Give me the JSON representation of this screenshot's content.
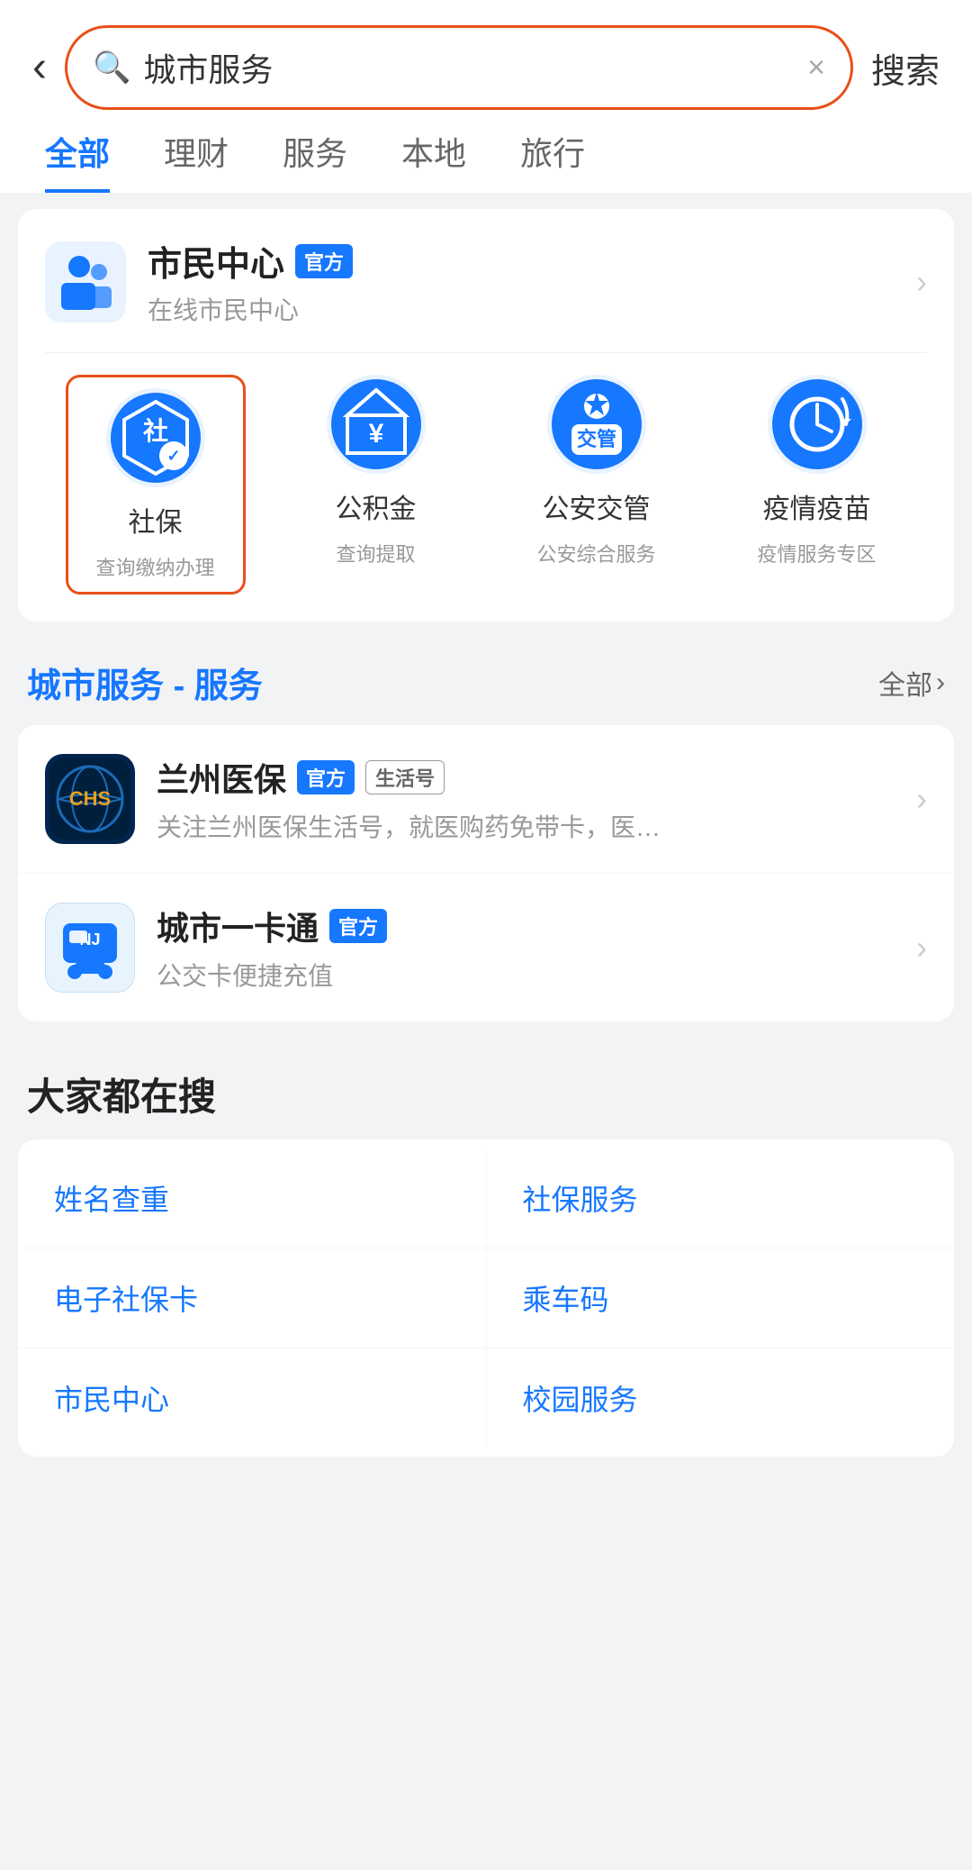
{
  "header": {
    "back_label": "‹",
    "search_value": "城市服务",
    "clear_icon": "×",
    "search_btn_label": "搜索"
  },
  "tabs": [
    {
      "label": "全部",
      "active": true
    },
    {
      "label": "理财",
      "active": false
    },
    {
      "label": "服务",
      "active": false
    },
    {
      "label": "本地",
      "active": false
    },
    {
      "label": "旅行",
      "active": false
    }
  ],
  "civic_card": {
    "title": "市民中心",
    "badge": "官方",
    "subtitle": "在线市民中心"
  },
  "service_items": [
    {
      "name": "社保",
      "desc": "查询缴纳办理",
      "highlighted": true
    },
    {
      "name": "公积金",
      "desc": "查询提取",
      "highlighted": false
    },
    {
      "name": "公安交管",
      "desc": "公安综合服务",
      "highlighted": false
    },
    {
      "name": "疫情疫苗",
      "desc": "疫情服务专区",
      "highlighted": false
    }
  ],
  "city_services_section": {
    "title_prefix": "城市服务",
    "title_suffix": " - 服务",
    "all_label": "全部",
    "chevron": "›"
  },
  "list_items": [
    {
      "name": "兰州医保",
      "badge_official": "官方",
      "badge_life": "生活号",
      "desc": "关注兰州医保生活号，就医购药免带卡，医…"
    },
    {
      "name": "城市一卡通",
      "badge_official": "官方",
      "badge_life": "",
      "desc": "公交卡便捷充值"
    }
  ],
  "popular_section": {
    "title": "大家都在搜",
    "items": [
      [
        "姓名查重",
        "社保服务"
      ],
      [
        "电子社保卡",
        "乘车码"
      ],
      [
        "市民中心",
        "校园服务"
      ]
    ]
  }
}
